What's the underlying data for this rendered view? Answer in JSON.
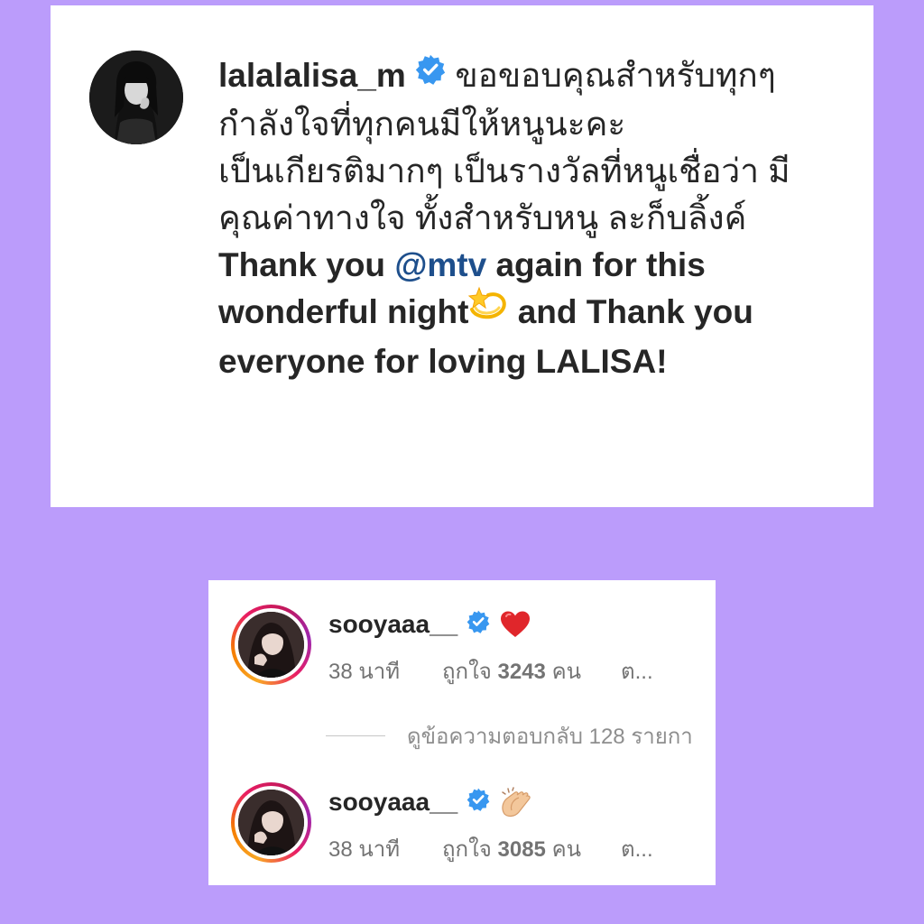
{
  "post": {
    "username": "lalalalisa_m",
    "caption_thai": "ขอขอบคุณสำหรับทุกๆกำลังใจที่ทุกคนมีให้หนูนะคะ",
    "caption_thai_2": "เป็นเกียรติมากๆ เป็นรางวัลที่หนูเชื่อว่า มีคุณค่าทางใจ ทั้งสำหรับหนู ละก็บลิ้งค์",
    "caption_en_1": "Thank you",
    "mention": "@mtv",
    "caption_en_2": "again for this wonderful night",
    "caption_en_3": "and Thank you everyone for loving LALISA!",
    "emoji_name": "dizzy-star-emoji"
  },
  "comments": [
    {
      "username": "sooyaaa__",
      "reaction_icon": "red-heart-emoji",
      "time": "38 นาที",
      "likes_prefix": "ถูกใจ",
      "likes_count": "3243",
      "likes_suffix": "คน",
      "reply_label": "ต..."
    },
    {
      "username": "sooyaaa__",
      "reaction_icon": "clapping-hands-emoji",
      "time": "38 นาที",
      "likes_prefix": "ถูกใจ",
      "likes_count": "3085",
      "likes_suffix": "คน",
      "reply_label": "ต..."
    }
  ],
  "view_replies": "ดูข้อความตอบกลับ 128 รายกา",
  "colors": {
    "background": "#bb9cfb",
    "verified": "#3897f0",
    "mention": "#1e4f8c",
    "meta_text": "#737373"
  }
}
